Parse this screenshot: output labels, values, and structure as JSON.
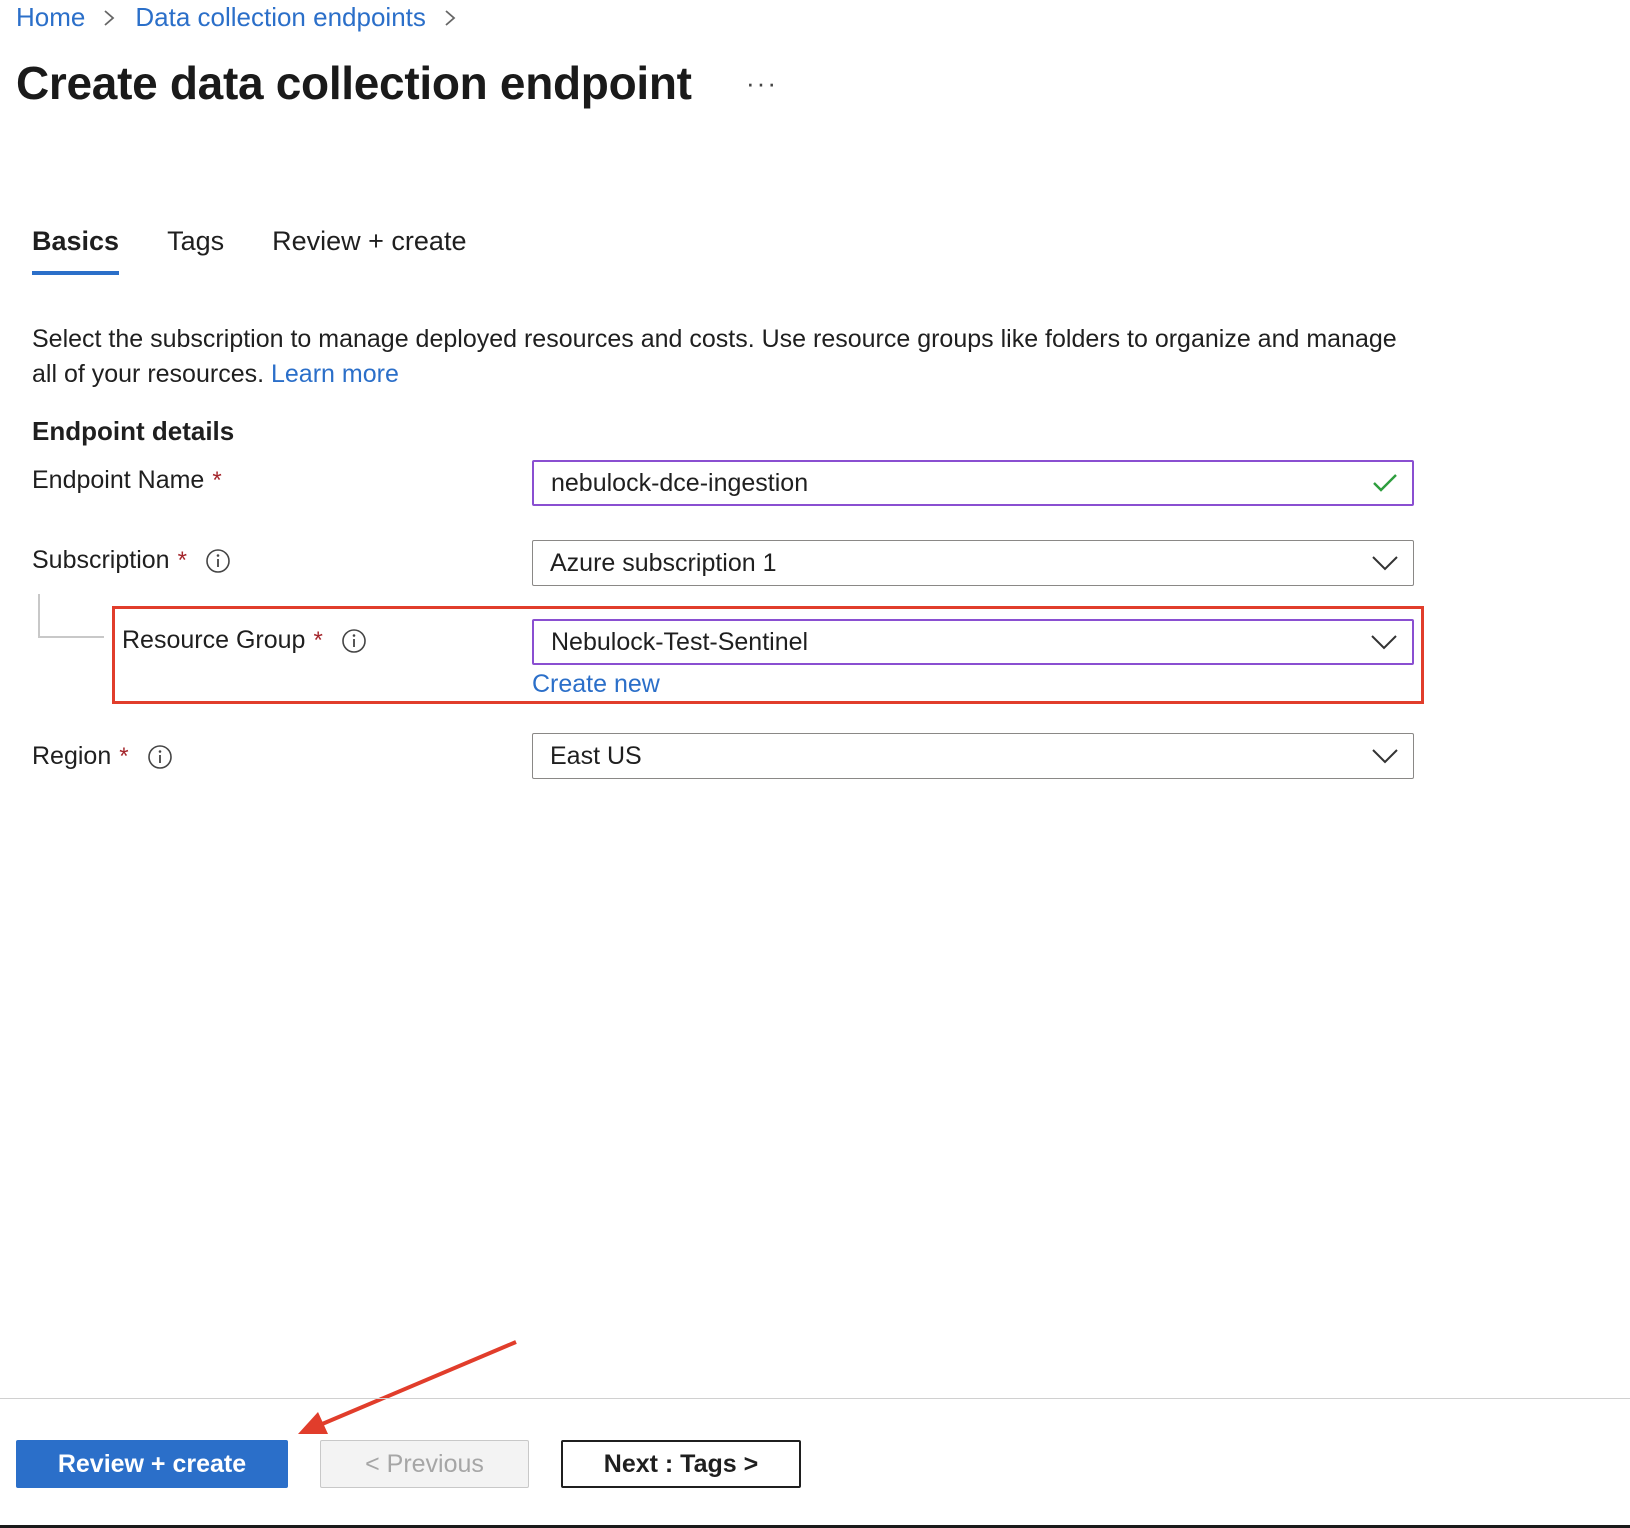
{
  "breadcrumb": {
    "home": "Home",
    "data_collection_endpoints": "Data collection endpoints"
  },
  "header": {
    "title": "Create data collection endpoint",
    "more": "···"
  },
  "tabs": [
    {
      "label": "Basics",
      "active": true
    },
    {
      "label": "Tags",
      "active": false
    },
    {
      "label": "Review + create",
      "active": false
    }
  ],
  "description": {
    "text": "Select the subscription to manage deployed resources and costs. Use resource groups like folders to organize and manage all of your resources.",
    "link": "Learn more"
  },
  "section": {
    "heading": "Endpoint details"
  },
  "fields": {
    "endpoint_name": {
      "label": "Endpoint Name",
      "required": "*",
      "value": "nebulock-dce-ingestion"
    },
    "subscription": {
      "label": "Subscription",
      "required": "*",
      "value": "Azure subscription 1"
    },
    "resource_group": {
      "label": "Resource Group",
      "required": "*",
      "value": "Nebulock-Test-Sentinel",
      "create_new": "Create new"
    },
    "region": {
      "label": "Region",
      "required": "*",
      "value": "East US"
    }
  },
  "footer": {
    "review_create": "Review + create",
    "previous": "< Previous",
    "next": "Next : Tags >"
  },
  "colors": {
    "accent": "#2b6fc9",
    "highlight": "#e13d2b",
    "focus": "#8a4fd1",
    "valid": "#2e9e3e",
    "required": "#a4262c"
  }
}
